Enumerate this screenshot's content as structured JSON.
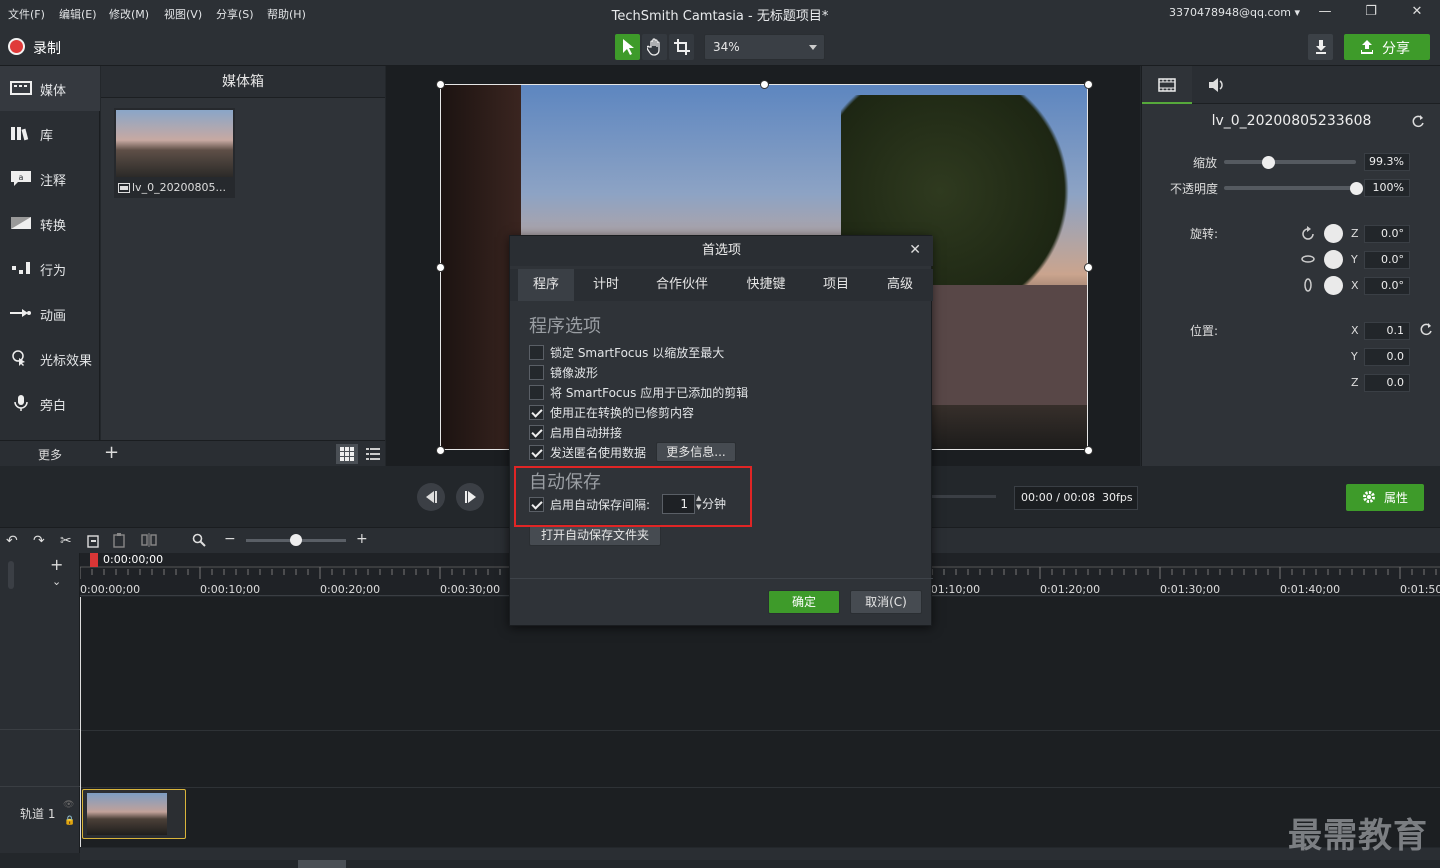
{
  "menu": [
    "文件(F)",
    "编辑(E)",
    "修改(M)",
    "视图(V)",
    "分享(S)",
    "帮助(H)"
  ],
  "app_title": "TechSmith Camtasia - 无标题项目*",
  "account": "3370478948@qq.com",
  "window_controls": {
    "minimize": "—",
    "restore": "❐",
    "close": "✕"
  },
  "toolbar": {
    "record_label": "录制",
    "zoom_value": "34%",
    "share_label": "分享"
  },
  "sidebar": {
    "items": [
      {
        "label": "媒体",
        "icon": "media-icon"
      },
      {
        "label": "库",
        "icon": "library-icon"
      },
      {
        "label": "注释",
        "icon": "annotation-icon"
      },
      {
        "label": "转换",
        "icon": "transition-icon"
      },
      {
        "label": "行为",
        "icon": "behavior-icon"
      },
      {
        "label": "动画",
        "icon": "animation-icon"
      },
      {
        "label": "光标效果",
        "icon": "cursor-effect-icon"
      },
      {
        "label": "旁白",
        "icon": "microphone-icon"
      }
    ],
    "more_label": "更多",
    "add_label": "+"
  },
  "media_bin": {
    "title": "媒体箱",
    "items": [
      {
        "name": "lv_0_20200805..."
      }
    ]
  },
  "properties": {
    "clip_name": "lv_0_20200805233608",
    "scale_label": "缩放",
    "scale_value": "99.3%",
    "scale_level": 0.33,
    "opacity_label": "不透明度",
    "opacity_value": "100%",
    "opacity_level": 1.0,
    "rotation_label": "旋转:",
    "rotation": [
      {
        "axis": "Z",
        "value": "0.0°"
      },
      {
        "axis": "Y",
        "value": "0.0°"
      },
      {
        "axis": "X",
        "value": "0.0°"
      }
    ],
    "position_label": "位置:",
    "position": [
      {
        "axis": "X",
        "value": "0.1"
      },
      {
        "axis": "Y",
        "value": "0.0"
      },
      {
        "axis": "Z",
        "value": "0.0"
      }
    ],
    "props_button": "属性"
  },
  "transport": {
    "time": "00:00 / 00:08",
    "fps": "30fps"
  },
  "timeline": {
    "playhead_time": "0:00:00;00",
    "ticks": [
      "0:00:00;00",
      "0:00:10;00",
      "0:00:20;00",
      "0:00:30;00",
      "0:01:10;00",
      "0:01:20;00",
      "0:01:30;00",
      "0:01:40;00",
      "0:01:50;00"
    ],
    "track_label": "轨道 1",
    "zoom_minus": "−",
    "zoom_plus": "+"
  },
  "dialog": {
    "title": "首选项",
    "close": "✕",
    "tabs": [
      "程序",
      "计时",
      "合作伙伴",
      "快捷键",
      "项目",
      "高级"
    ],
    "section_program": "程序选项",
    "options": [
      {
        "label": "锁定 SmartFocus 以缩放至最大",
        "checked": false
      },
      {
        "label": "镜像波形",
        "checked": false
      },
      {
        "label": "将 SmartFocus 应用于已添加的剪辑",
        "checked": false
      },
      {
        "label": "使用正在转换的已修剪内容",
        "checked": true
      },
      {
        "label": "启用自动拼接",
        "checked": true
      },
      {
        "label": "发送匿名使用数据",
        "checked": true
      }
    ],
    "more_info_button": "更多信息...",
    "section_autosave": "自动保存",
    "autosave_label": "启用自动保存间隔:",
    "autosave_checked": true,
    "autosave_interval": "1",
    "autosave_unit": "分钟",
    "open_folder_button": "打开自动保存文件夹",
    "ok_button": "确定",
    "cancel_button": "取消(C)"
  },
  "watermark": "最需教育",
  "colors": {
    "accent_green": "#3e9b2a",
    "highlight_red": "#e02525",
    "record_red": "#e03a3a"
  }
}
